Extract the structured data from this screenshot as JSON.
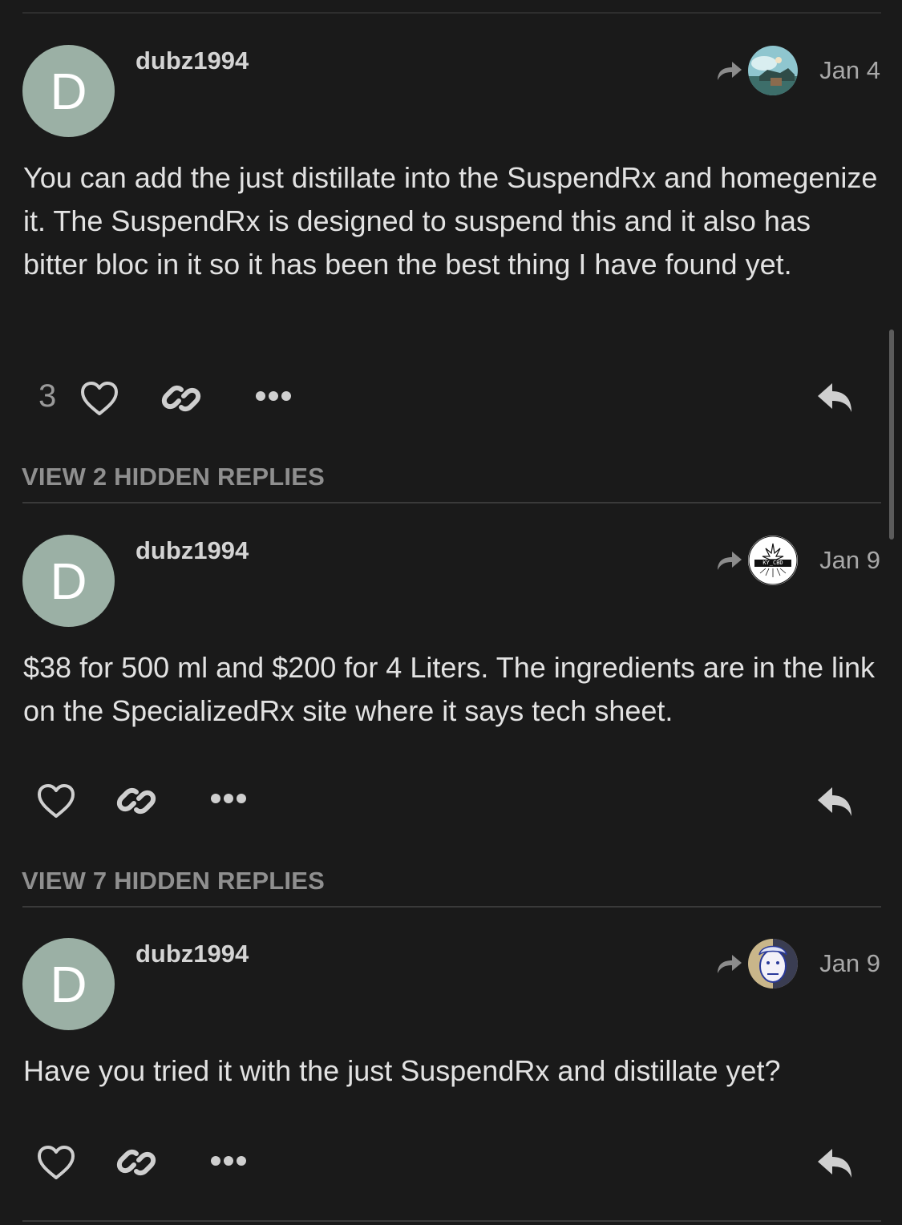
{
  "colors": {
    "background": "#1a1a1a",
    "avatar_bg": "#9bb0a5",
    "muted_text": "#8f8f8f"
  },
  "posts": [
    {
      "username": "dubz1994",
      "avatar_letter": "D",
      "date": "Jan 4",
      "reply_to_avatar": "landscape-avatar",
      "text": "You can add the just distillate into the SuspendRx and homegenize it. The SuspendRx is designed to suspend this and it also has bitter bloc in it so it has been the best thing I have found yet.",
      "like_count": "3",
      "hidden_replies": "VIEW 2 HIDDEN REPLIES"
    },
    {
      "username": "dubz1994",
      "avatar_letter": "D",
      "date": "Jan 9",
      "reply_to_avatar": "ky-cbd-logo-avatar",
      "reply_to_avatar_text": "KY_CBD",
      "text": "$38 for 500 ml and $200 for 4 Liters. The ingredients are in the link on the SpecializedRx site where it says tech sheet.",
      "hidden_replies": "VIEW 7 HIDDEN REPLIES"
    },
    {
      "username": "dubz1994",
      "avatar_letter": "D",
      "date": "Jan 9",
      "reply_to_avatar": "cartoon-face-avatar",
      "text": "Have you tried it with the just SuspendRx and distillate yet?"
    }
  ],
  "icons": {
    "reply_to": "share-arrow-icon",
    "like": "heart-icon",
    "link": "link-icon",
    "more": "more-dots-icon",
    "reply": "reply-icon"
  }
}
